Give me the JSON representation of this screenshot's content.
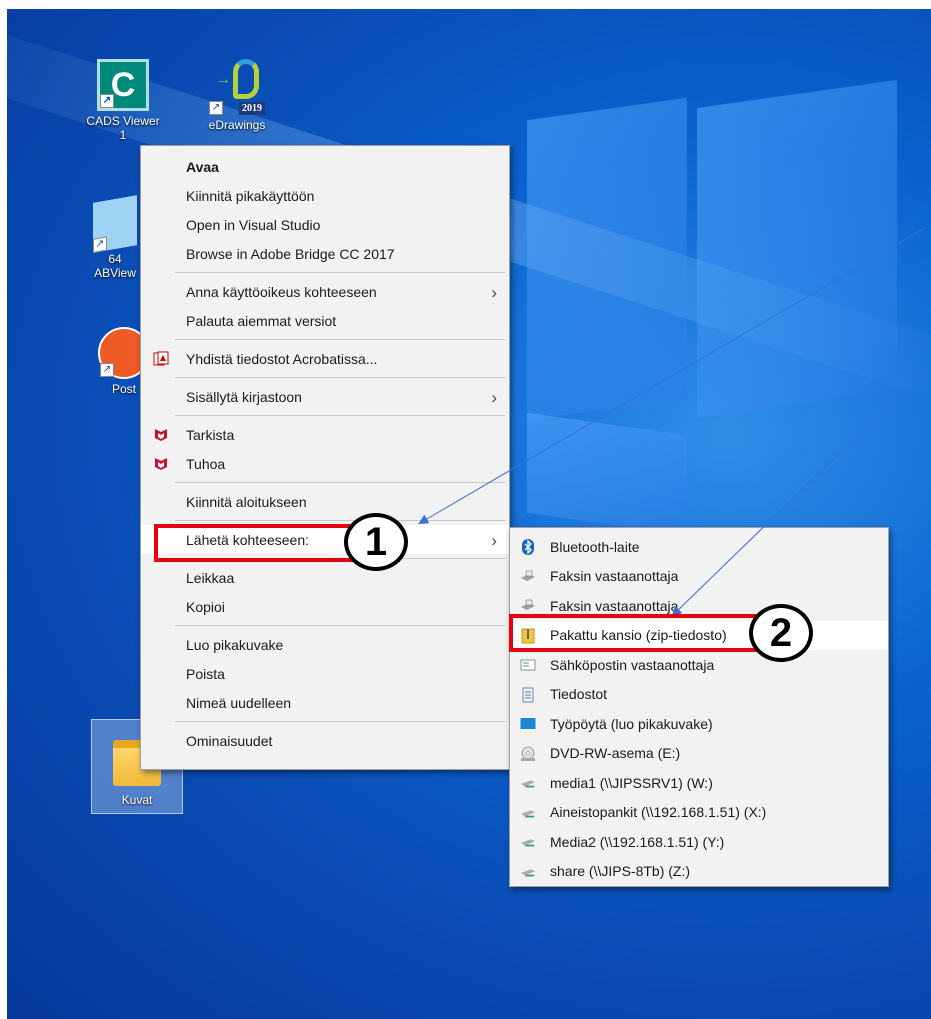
{
  "desktop_icons": [
    {
      "name": "cads",
      "label": "CADS Viewer",
      "label2": "1"
    },
    {
      "name": "edrawings",
      "label": "eDrawings",
      "badge": "2019"
    },
    {
      "name": "abviewer",
      "label": "ABView",
      "label_top": "64"
    },
    {
      "name": "postman",
      "label": "Post"
    },
    {
      "name": "kuvat",
      "label": "Kuvat"
    }
  ],
  "context_menu": {
    "items": [
      {
        "label": "Avaa",
        "bold": true
      },
      {
        "label": "Kiinnitä pikakäyttöön"
      },
      {
        "label": "Open in Visual Studio"
      },
      {
        "label": "Browse in Adobe Bridge CC 2017"
      },
      {
        "label": "Anna käyttöoikeus kohteeseen",
        "submenu": true
      },
      {
        "label": "Palauta aiemmat versiot"
      },
      {
        "label": "Yhdistä tiedostot Acrobatissa...",
        "icon": "acrobat-icon"
      },
      {
        "label": "Sisällytä kirjastoon",
        "submenu": true
      },
      {
        "label": "Tarkista",
        "icon": "mcafee-icon"
      },
      {
        "label": "Tuhoa",
        "icon": "mcafee-icon"
      },
      {
        "label": "Kiinnitä aloitukseen"
      },
      {
        "label": "Lähetä kohteeseen:",
        "submenu": true
      },
      {
        "label": "Leikkaa"
      },
      {
        "label": "Kopioi"
      },
      {
        "label": "Luo pikakuvake"
      },
      {
        "label": "Poista"
      },
      {
        "label": "Nimeä uudelleen"
      },
      {
        "label": "Ominaisuudet"
      }
    ]
  },
  "send_to_menu": {
    "items": [
      {
        "label": "Bluetooth-laite",
        "icon": "bluetooth-icon"
      },
      {
        "label": "Faksin vastaanottaja",
        "icon": "fax-icon"
      },
      {
        "label": "Faksin vastaanottaja",
        "icon": "fax-icon"
      },
      {
        "label": "Pakattu kansio (zip-tiedosto)",
        "icon": "zip-folder-icon"
      },
      {
        "label": "Sähköpostin vastaanottaja",
        "icon": "mail-icon"
      },
      {
        "label": "Tiedostot",
        "icon": "document-icon"
      },
      {
        "label": "Työpöytä (luo pikakuvake)",
        "icon": "desktop-icon"
      },
      {
        "label": "DVD-RW-asema (E:)",
        "icon": "dvd-icon"
      },
      {
        "label": "media1 (\\\\JIPSSRV1) (W:)",
        "icon": "network-drive-icon"
      },
      {
        "label": "Aineistopankit (\\\\192.168.1.51) (X:)",
        "icon": "network-drive-icon"
      },
      {
        "label": "Media2 (\\\\192.168.1.51) (Y:)",
        "icon": "network-drive-icon"
      },
      {
        "label": "share (\\\\JIPS-8Tb) (Z:)",
        "icon": "network-drive-icon"
      }
    ]
  },
  "annotations": {
    "step1": "1",
    "step2": "2"
  },
  "colors": {
    "highlight": "#e60012",
    "arrow": "#3a6fd8",
    "desktop": "#0a63d0"
  }
}
